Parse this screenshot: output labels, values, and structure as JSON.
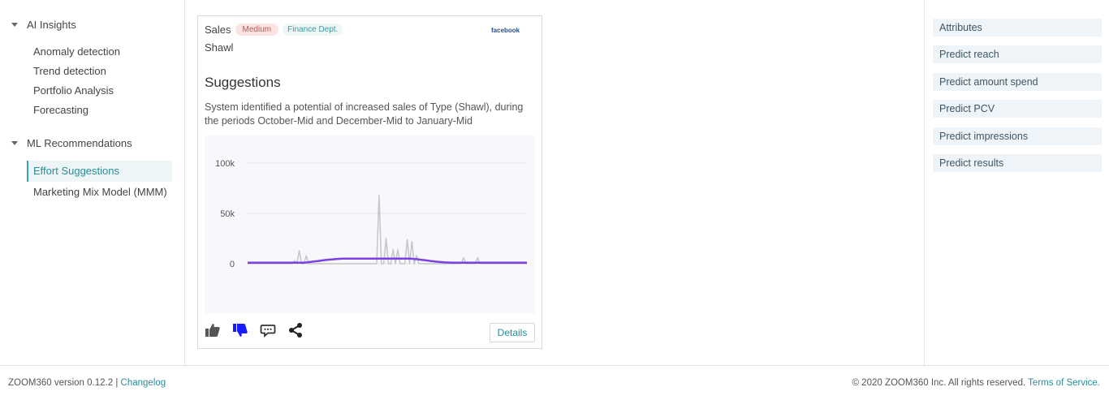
{
  "sidebar": {
    "sections": [
      {
        "title": "AI Insights",
        "items": [
          "Anomaly detection",
          "Trend detection",
          "Portfolio Analysis",
          "Forecasting"
        ]
      },
      {
        "title": "ML Recommendations",
        "items": [
          "Effort Suggestions",
          "Marketing Mix Model (MMM)"
        ]
      }
    ],
    "active_item": "Effort Suggestions"
  },
  "card": {
    "category": "Sales",
    "priority_badge": "Medium",
    "department_badge": "Finance Dept.",
    "platform_logo": "facebook",
    "product": "Shawl",
    "title": "Suggestions",
    "description": "System identified a potential of increased sales of Type (Shawl), during the periods October-Mid and December-Mid to January-Mid",
    "actions": {
      "like_icon": "thumbs-up-icon",
      "dislike_icon": "thumbs-down-icon",
      "comment_icon": "comment-icon",
      "share_icon": "share-icon"
    },
    "details_label": "Details",
    "colors": {
      "trend_line": "#7b3fe4",
      "raw_line": "#c4c6c9",
      "dislike_active": "#1a1aff"
    }
  },
  "chart_data": {
    "type": "line",
    "y_ticks": [
      "100k",
      "50k",
      "0"
    ],
    "ylim": [
      0,
      100000
    ],
    "grid": true,
    "series": [
      {
        "values": [
          0,
          0,
          0,
          0,
          0,
          0,
          0,
          0,
          0,
          0,
          0,
          0,
          0,
          0,
          0,
          0,
          0,
          0,
          0,
          0,
          3000,
          0,
          13000,
          0,
          0,
          8000,
          0,
          0,
          0,
          0,
          0,
          0,
          0,
          0,
          0,
          0,
          0,
          0,
          0,
          0,
          0,
          0,
          0,
          0,
          0,
          0,
          0,
          0,
          0,
          0,
          0,
          0,
          0,
          0,
          0,
          0,
          68000,
          0,
          0,
          25000,
          0,
          0,
          14000,
          0,
          14000,
          0,
          0,
          0,
          24000,
          0,
          22000,
          0,
          8000,
          0,
          0,
          0,
          0,
          0,
          0,
          0,
          0,
          0,
          0,
          0,
          0,
          0,
          0,
          0,
          0,
          0,
          0,
          0,
          6000,
          0,
          0,
          0,
          0,
          0,
          6000,
          0,
          0,
          0,
          0,
          0,
          0,
          0,
          0,
          0,
          0,
          0,
          0,
          0,
          0,
          0,
          0,
          0,
          0,
          0,
          0,
          0
        ]
      },
      {
        "values": [
          1000,
          1000,
          1000,
          1000,
          1000,
          1000,
          1000,
          1000,
          1000,
          1000,
          1000,
          1000,
          1000,
          1000,
          1000,
          1000,
          1000,
          1000,
          1000,
          1000,
          1000,
          1000,
          1000,
          1000,
          1000,
          1200,
          1500,
          1800,
          2100,
          2400,
          2700,
          3000,
          3300,
          3600,
          3900,
          4100,
          4300,
          4500,
          4700,
          4800,
          4900,
          5000,
          5000,
          5000,
          5000,
          5000,
          5000,
          5000,
          5000,
          5000,
          5000,
          5000,
          5000,
          5000,
          5000,
          5000,
          5000,
          5000,
          5000,
          5000,
          5000,
          5000,
          5000,
          5000,
          5000,
          5000,
          5000,
          5000,
          5000,
          5000,
          4900,
          4700,
          4500,
          4200,
          3900,
          3600,
          3300,
          3000,
          2700,
          2400,
          2100,
          1900,
          1700,
          1500,
          1300,
          1200,
          1100,
          1000,
          1000,
          1000,
          1000,
          1000,
          1000,
          1000,
          1000,
          1000,
          1000,
          1000,
          1000,
          1000,
          1000,
          1000,
          1000,
          1000,
          1000,
          1000,
          1000,
          1000,
          1000,
          1000,
          1000,
          1000,
          1000,
          1000,
          1000,
          1000,
          1000,
          1000,
          1000,
          1000
        ]
      }
    ]
  },
  "right_panel": {
    "items": [
      "Attributes",
      "Predict reach",
      "Predict amount spend",
      "Predict PCV",
      "Predict impressions",
      "Predict results"
    ]
  },
  "footer": {
    "version": "ZOOM360 version 0.12.2",
    "separator": "|",
    "changelog": "Changelog",
    "copyright": "© 2020 ZOOM360 Inc. All rights reserved.",
    "terms": "Terms of Service."
  }
}
